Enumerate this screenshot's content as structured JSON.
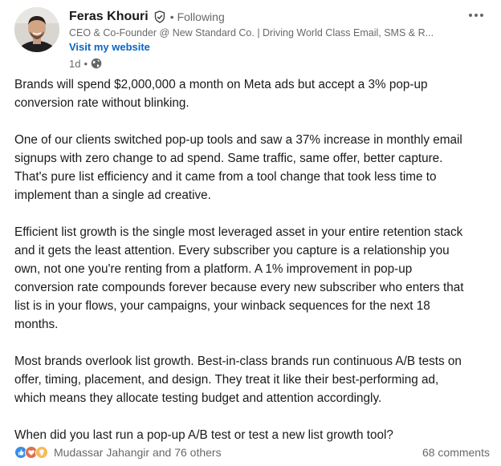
{
  "post": {
    "author": {
      "name": "Feras Khouri",
      "verified_icon": "verified-badge-icon",
      "relationship": "Following",
      "headline": "CEO & Co-Founder @ New Standard Co. | Driving World Class Email, SMS & R...",
      "website_link": "Visit my website",
      "time_ago": "1d",
      "visibility_icon": "globe-icon"
    },
    "more_icon": "more-options-icon",
    "paragraphs": [
      "Brands will spend $2,000,000 a month on Meta ads but accept a 3% pop-up\nconversion rate without blinking.",
      "One of our clients switched pop-up tools and saw a 37% increase in monthly email\nsignups with zero change to ad spend. Same traffic, same offer, better capture.\nThat's pure list efficiency and it came from a tool change that took less time to\nimplement than a single ad creative.",
      "Efficient list growth is the single most leveraged asset in your entire retention stack\nand it gets the least attention. Every subscriber you capture is a relationship you\nown, not one you're renting from a platform. A 1% improvement in pop-up\nconversion rate compounds forever because every new subscriber who enters that\nlist is in your flows, your campaigns, your winback sequences for the next 18\nmonths.",
      "Most brands overlook list growth. Best-in-class brands run continuous A/B tests on\noffer, timing, placement, and design. They treat it like their best-performing ad,\nwhich means they allocate testing budget and attention accordingly.",
      "When did you last run a pop-up A/B test or test a new list growth tool?"
    ],
    "social": {
      "reaction_icons": [
        "like-icon",
        "love-icon",
        "insightful-icon"
      ],
      "reactions_text": "Mudassar Jahangir and 76 others",
      "comments_text": "68 comments"
    },
    "colors": {
      "link_blue": "#0a66c2",
      "like_blue": "#378fe9",
      "love_red": "#df704d",
      "insightful_yellow": "#f5bb5c"
    }
  }
}
